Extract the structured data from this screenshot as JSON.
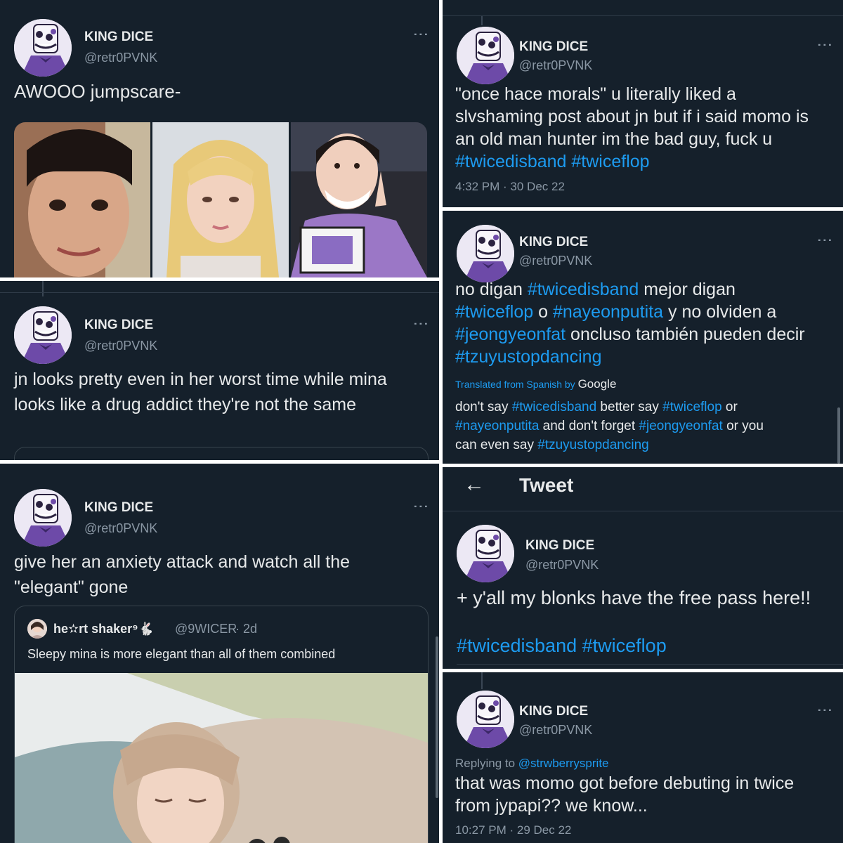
{
  "profile": {
    "name": "KING DICE",
    "handle": "@retr0PVNK"
  },
  "tweet1": {
    "text": "AWOOO jumpscare-"
  },
  "tweet2": {
    "text": "jn looks pretty even in her worst time while mina looks like a drug addict they're not the same"
  },
  "tweet3": {
    "text": "give her an anxiety attack and watch all the \"elegant\" gone",
    "quote": {
      "author": "he✫rt shaker⁹🐇",
      "handle": "@9WICER",
      "time": "· 2d",
      "text": "Sleepy mina is more elegant than all of them combined"
    }
  },
  "tweet4": {
    "text_plain": "\"once hace morals\" u literally liked a slvshaming post about jn but if i said momo is an old man hunter im the bad guy, fuck u",
    "tags": [
      "#twicedisband",
      "#twiceflop"
    ],
    "timestamp": "4:32 PM · 30 Dec 22"
  },
  "tweet5": {
    "line1_a": "no digan ",
    "line1_tag": "#twicedisband",
    "line1_b": " mejor digan",
    "line2_tag1": "#twiceflop",
    "line2_mid": " o ",
    "line2_tag2": "#nayeonputita",
    "line2_b": " y no olviden a",
    "line3_tag": "#jeongyeonfat",
    "line3_b": " oncluso también pueden decir",
    "line4_tag": "#tzuyustopdancing",
    "translated_prefix": "Translated from Spanish by",
    "translated_by": "Google",
    "translation": {
      "a": "don't say ",
      "t1": "#twicedisband",
      "b": " better say ",
      "t2": "#twiceflop",
      "c": " or",
      "t3": "#nayeonputita",
      "d": " and don't forget ",
      "t4": "#jeongyeonfat",
      "e": " or you",
      "f": "can even say ",
      "t5": "#tzuyustopdancing"
    }
  },
  "tweet_header": {
    "back_icon": "←",
    "title": "Tweet"
  },
  "tweet6": {
    "text": "+ y'all my blonks have the free pass here!!",
    "tags": [
      "#twicedisband",
      "#twiceflop"
    ]
  },
  "tweet7": {
    "replying_prefix": "Replying to ",
    "replying_to": "@strwberrysprite",
    "text": "that was momo got before debuting in twice from jypapi?? we know...",
    "timestamp": "10:27 PM · 29 Dec 22"
  }
}
